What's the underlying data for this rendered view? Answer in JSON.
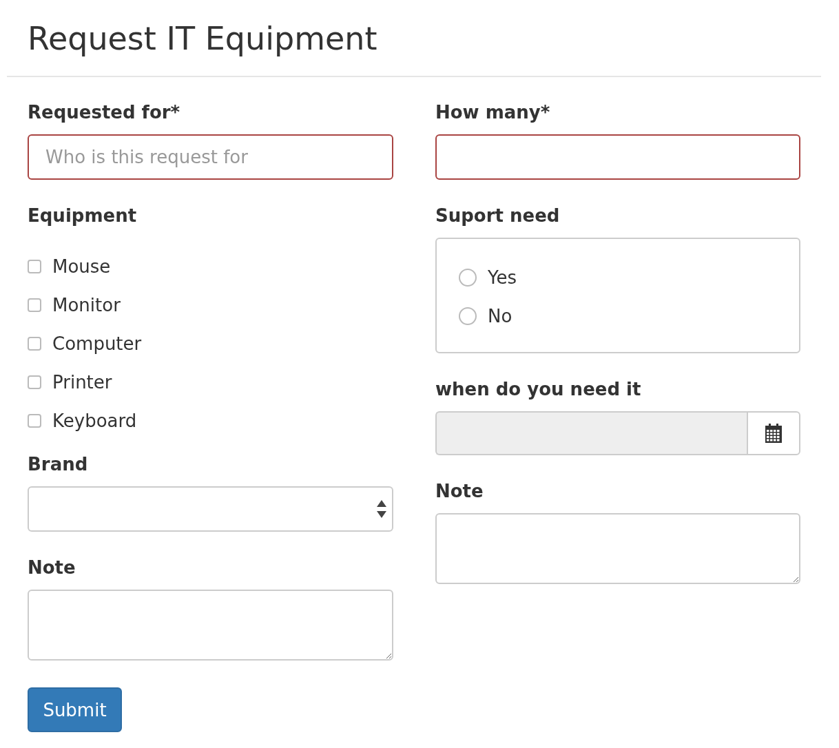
{
  "title": "Request IT Equipment",
  "columns": [
    {
      "fields": [
        {
          "kind": "text",
          "label": "Requested for*",
          "placeholder": "Who is this request for",
          "error": true
        },
        {
          "kind": "checkboxes",
          "label": "Equipment",
          "options": [
            {
              "label": "Mouse",
              "checked": false
            },
            {
              "label": "Monitor",
              "checked": false
            },
            {
              "label": "Computer",
              "checked": false
            },
            {
              "label": "Printer",
              "checked": false
            },
            {
              "label": "Keyboard",
              "checked": false
            }
          ]
        },
        {
          "kind": "select",
          "label": "Brand"
        },
        {
          "kind": "textarea",
          "label": "Note"
        }
      ]
    },
    {
      "fields": [
        {
          "kind": "text",
          "label": "How many*",
          "error": true
        },
        {
          "kind": "radios",
          "label": "Suport need",
          "options": [
            {
              "label": "Yes",
              "selected": false
            },
            {
              "label": "No",
              "selected": false
            }
          ]
        },
        {
          "kind": "date",
          "label": "when do you need it",
          "disabled": true
        },
        {
          "kind": "textarea",
          "label": "Note"
        }
      ]
    }
  ],
  "submit": "Submit"
}
